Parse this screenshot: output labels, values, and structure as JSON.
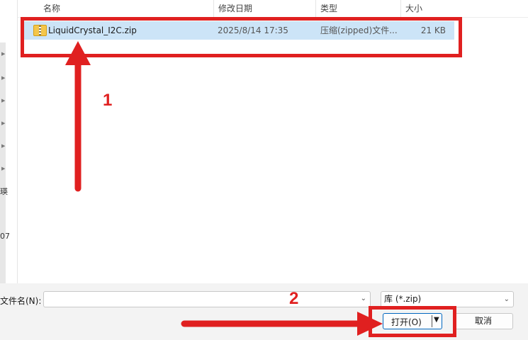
{
  "columns": {
    "name": "名称",
    "modified": "修改日期",
    "type": "类型",
    "size": "大小"
  },
  "files": [
    {
      "name": "LiquidCrystal_I2C.zip",
      "modified": "2025/8/14 17:35",
      "type": "压缩(zipped)文件...",
      "size": "21 KB",
      "icon": "zip-folder-icon"
    }
  ],
  "left_fragments": [
    "瑛",
    "07"
  ],
  "filename": {
    "label": "文件名(N):",
    "value": ""
  },
  "filetype": {
    "selected": "库 (*.zip)"
  },
  "buttons": {
    "open": "打开(O)",
    "cancel": "取消"
  },
  "annotations": {
    "step1": "1",
    "step2": "2",
    "color": "#e02020"
  },
  "colors": {
    "selection": "#cce4f7",
    "accent": "#0067c0"
  }
}
